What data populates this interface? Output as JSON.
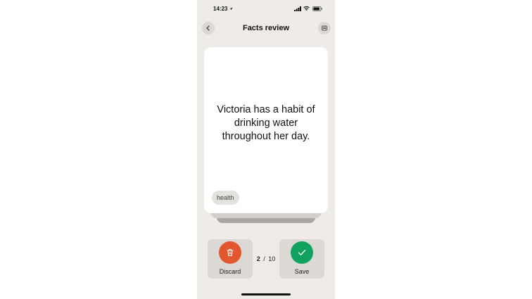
{
  "status_bar": {
    "time": "14:23"
  },
  "header": {
    "title": "Facts review",
    "back_icon": "chevron-left-icon",
    "menu_icon": "list-icon"
  },
  "card": {
    "text": "Victoria has a habit of drinking water throughout her day.",
    "tag": "health"
  },
  "actions": {
    "discard_label": "Discard",
    "save_label": "Save",
    "discard_icon": "trash-icon",
    "save_icon": "checkmark-icon"
  },
  "progress": {
    "current": "2",
    "separator": "/",
    "total": "10"
  },
  "colors": {
    "background": "#efebe7",
    "discard": "#e2572f",
    "save": "#12a25f",
    "card": "#ffffff"
  }
}
